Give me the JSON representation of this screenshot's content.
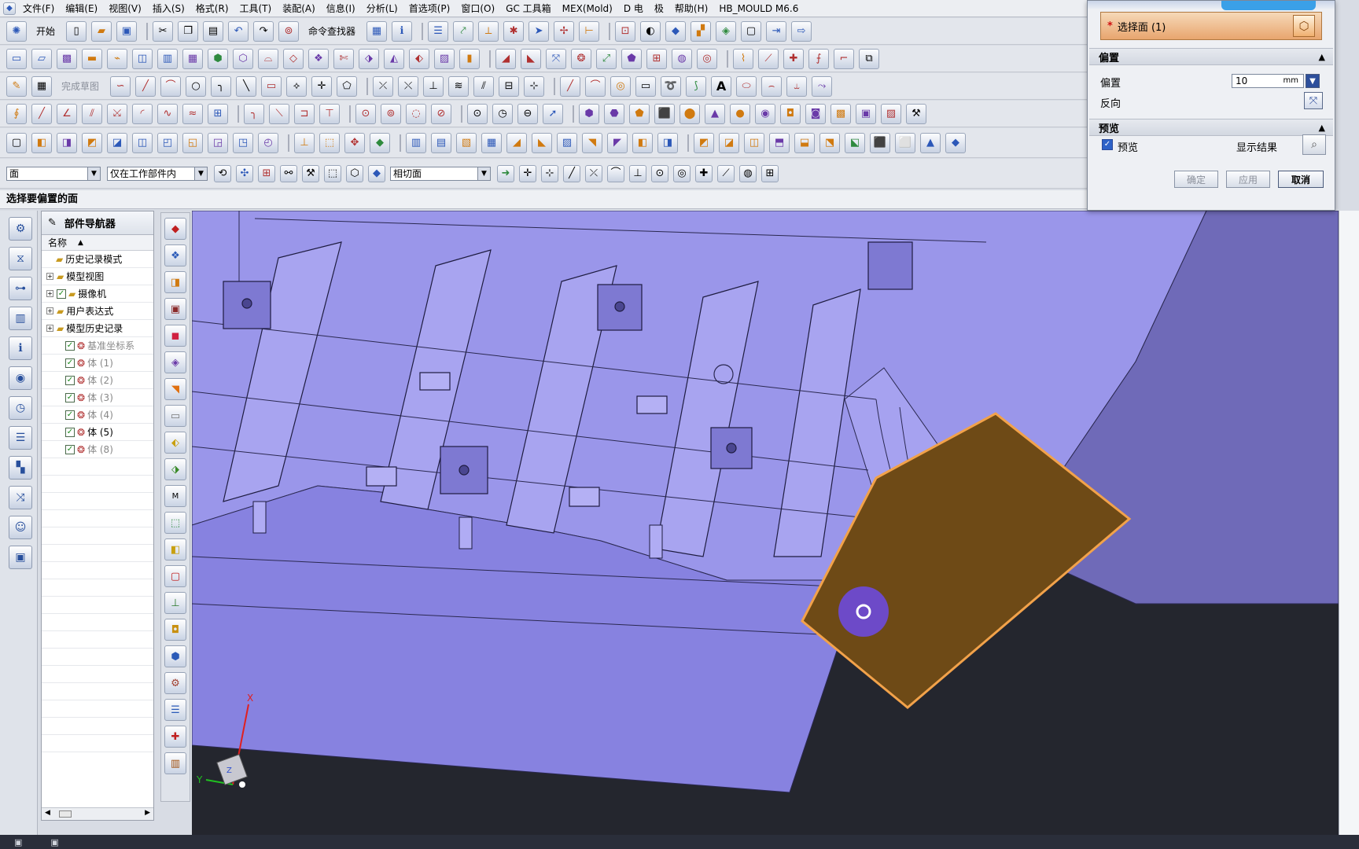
{
  "menu": [
    "文件(F)",
    "编辑(E)",
    "视图(V)",
    "插入(S)",
    "格式(R)",
    "工具(T)",
    "装配(A)",
    "信息(I)",
    "分析(L)",
    "首选项(P)",
    "窗口(O)",
    "GC 工具箱",
    "MEX(Mold)",
    "D 电",
    "极",
    "帮助(H)",
    "HB_MOULD M6.6"
  ],
  "toolbar1": {
    "start_label": "开始",
    "cmdfinder_label": "命令查找器"
  },
  "toolbar3": {
    "finish_sketch_label": "完成草图"
  },
  "selbar": {
    "filter_value": "面",
    "scope_value": "仅在工作部件内",
    "snap_value": "相切面"
  },
  "cue_line": "选择要偏置的面",
  "navigator": {
    "title": "部件导航器",
    "column_header": "名称",
    "items": [
      {
        "label": "历史记录模式",
        "indent": 1,
        "dim": false,
        "checked": false
      },
      {
        "label": "模型视图",
        "indent": 0,
        "dim": false,
        "checked": false
      },
      {
        "label": "摄像机",
        "indent": 0,
        "dim": false,
        "checked": true
      },
      {
        "label": "用户表达式",
        "indent": 0,
        "dim": false,
        "checked": false
      },
      {
        "label": "模型历史记录",
        "indent": 0,
        "dim": false,
        "checked": false
      },
      {
        "label": "基准坐标系",
        "indent": 2,
        "dim": true,
        "checked": true
      },
      {
        "label": "体 (1)",
        "indent": 2,
        "dim": true,
        "checked": true
      },
      {
        "label": "体 (2)",
        "indent": 2,
        "dim": true,
        "checked": true
      },
      {
        "label": "体 (3)",
        "indent": 2,
        "dim": true,
        "checked": true
      },
      {
        "label": "体 (4)",
        "indent": 2,
        "dim": true,
        "checked": true
      },
      {
        "label": "体 (5)",
        "indent": 2,
        "dim": false,
        "checked": true
      },
      {
        "label": "体 (8)",
        "indent": 2,
        "dim": true,
        "checked": true
      }
    ]
  },
  "dialog": {
    "select_face_label": "选择面 (1)",
    "offset_section": "偏置",
    "offset_label": "偏置",
    "offset_value": "10",
    "offset_unit": "mm",
    "reverse_label": "反向",
    "preview_section": "预览",
    "preview_label": "预览",
    "show_result_label": "显示结果",
    "ok_label": "确定",
    "apply_label": "应用",
    "cancel_label": "取消"
  },
  "triad": {
    "x_label": "X",
    "y_label": "Y",
    "z_label": "Z"
  },
  "colors": {
    "model_face": "#9a96ea",
    "selected_face": "#6e4a16",
    "selection_outline": "#f2a24a",
    "viewport_bg": "#24262e"
  }
}
